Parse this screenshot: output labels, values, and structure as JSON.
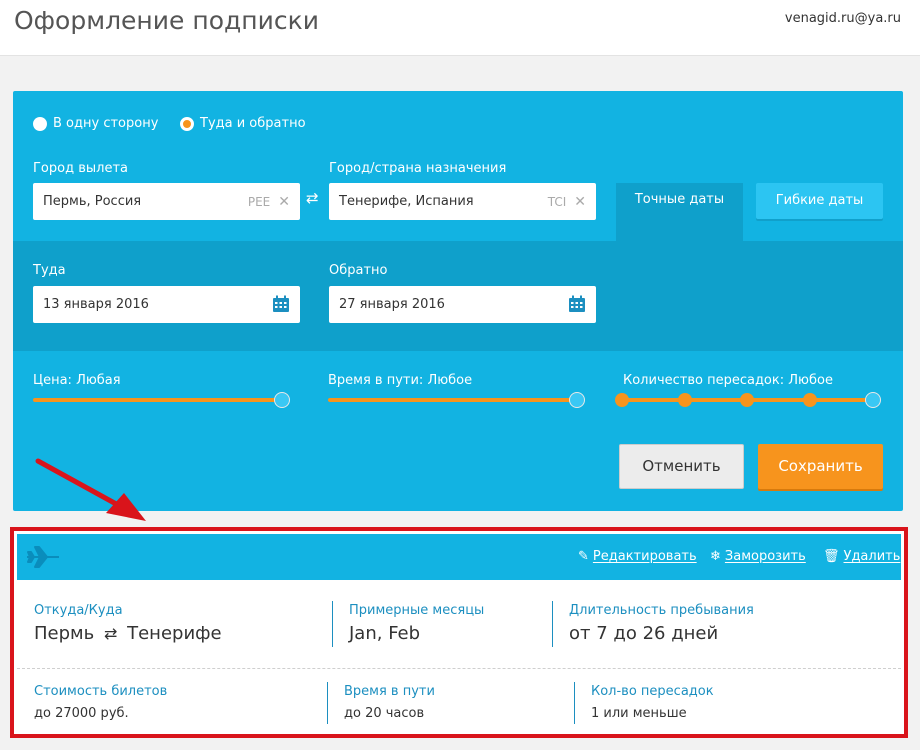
{
  "header": {
    "title": "Оформление подписки",
    "user_email": "venagid.ru@ya.ru"
  },
  "trip_type": {
    "one_way": "В одну сторону",
    "round_trip": "Туда и обратно",
    "selected": "round_trip"
  },
  "route": {
    "from_label": "Город вылета",
    "from_value": "Пермь, Россия",
    "from_code": "PEE",
    "to_label": "Город/страна назначения",
    "to_value": "Тенерифе, Испания",
    "to_code": "TCI"
  },
  "date_tabs": {
    "exact": "Точные даты",
    "flexible": "Гибкие даты",
    "active": "exact"
  },
  "dates": {
    "depart_label": "Туда",
    "depart_value": "13 января 2016",
    "return_label": "Обратно",
    "return_value": "27 января 2016"
  },
  "filters": {
    "price_label": "Цена: Любая",
    "duration_label": "Время в пути: Любое",
    "stops_label": "Количество пересадок: Любое",
    "price_fill": 1.0,
    "duration_fill": 1.0,
    "stops_fill": 1.0
  },
  "buttons": {
    "cancel": "Отменить",
    "save": "Сохранить"
  },
  "subscription_card": {
    "actions": {
      "edit": "Редактировать",
      "freeze": "Заморозить",
      "delete": "Удалить"
    },
    "from_to_label": "Откуда/Куда",
    "from_city": "Пермь",
    "to_city": "Тенерифе",
    "months_label": "Примерные месяцы",
    "months_value": "Jan, Feb",
    "stay_label": "Длительность пребывания",
    "stay_value": "от 7 до 26 дней",
    "price_label": "Стоимость билетов",
    "price_value": "до 27000 руб.",
    "travel_label": "Время в пути",
    "travel_value": "до 20 часов",
    "stops_label": "Кол-во пересадок",
    "stops_value": "1 или меньше"
  },
  "colors": {
    "panel": "#12b3e2",
    "accent": "#f7941d",
    "highlight_frame": "#d9141b",
    "link": "#1c8fc0"
  }
}
